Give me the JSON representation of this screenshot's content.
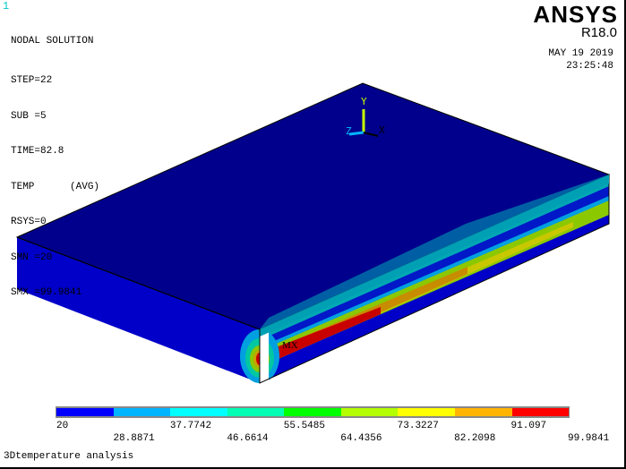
{
  "window_number": "1",
  "info": [
    "NODAL SOLUTION",
    "STEP=22",
    "SUB =5",
    "TIME=82.8",
    "TEMP      (AVG)",
    "RSYS=0",
    "SMN =20",
    "SMX =99.9841"
  ],
  "logo": "ANSYS",
  "version": "R18.0",
  "date": "MAY 19 2019",
  "time": "23:25:48",
  "axes": {
    "x": "X",
    "y": "Y",
    "z": "Z"
  },
  "max_marker": "MX",
  "legend": {
    "colors": [
      "#0000ff",
      "#00b4ff",
      "#00ffff",
      "#00ffb4",
      "#00ff00",
      "#b4ff00",
      "#ffff00",
      "#ffb400",
      "#ff0000"
    ],
    "labels_top": [
      "20",
      "37.7742",
      "55.5485",
      "73.3227",
      "91.097"
    ],
    "labels_bottom": [
      "28.8871",
      "46.6614",
      "64.4356",
      "82.2098",
      "99.9841"
    ]
  },
  "title": "3Dtemperature analysis"
}
